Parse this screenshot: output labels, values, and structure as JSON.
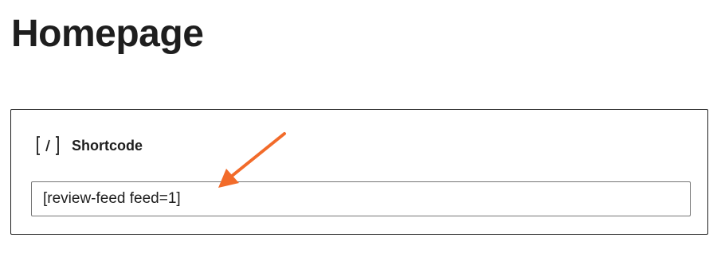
{
  "page": {
    "title": "Homepage"
  },
  "block": {
    "icon": "shortcode-icon",
    "label": "Shortcode",
    "input_value": "[review-feed feed=1]"
  },
  "annotation": {
    "arrow_color": "#f26b2a"
  }
}
